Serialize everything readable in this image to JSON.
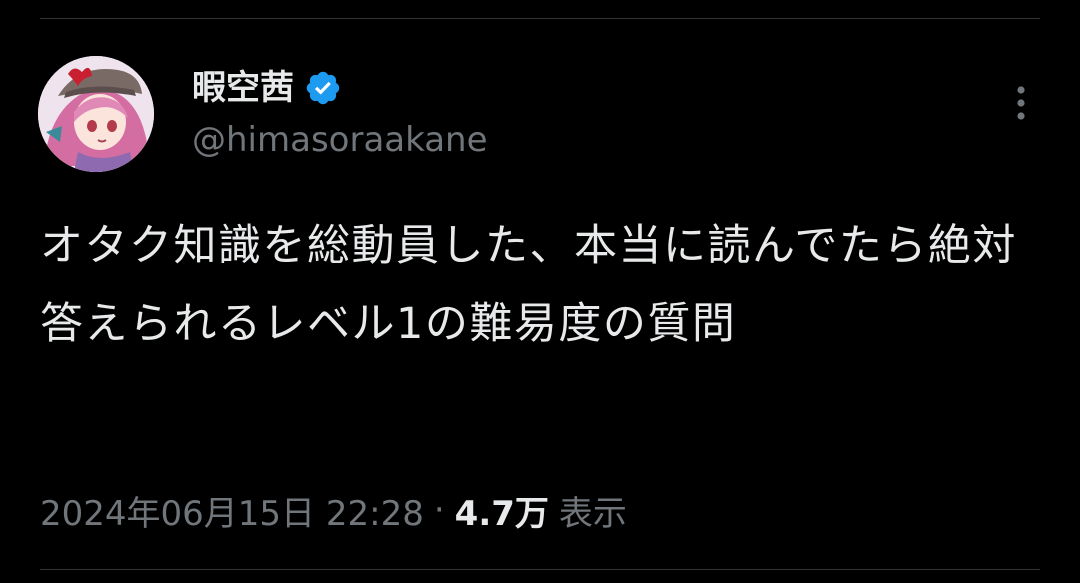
{
  "tweet": {
    "author": {
      "display_name": "暇空茜",
      "handle": "@himasoraakane",
      "verified": true,
      "avatar_icon": "anime-avatar-icon"
    },
    "text": "オタク知識を総動員した、本当に読んでたら絶対答えられるレベル1の難易度の質問",
    "timestamp": "2024年06月15日 22:28",
    "separator": "·",
    "views_count": "4.7万",
    "views_label": "表示"
  },
  "icons": {
    "verified": "verified-badge-icon",
    "more": "more-vertical-icon"
  },
  "colors": {
    "background": "#000000",
    "primary_text": "#e7e9ea",
    "secondary_text": "#71767b",
    "verified_blue": "#1d9bf0",
    "divider": "#2f3336"
  }
}
